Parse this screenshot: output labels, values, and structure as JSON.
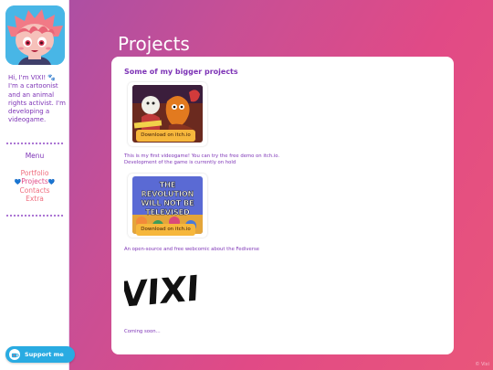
{
  "sidebar": {
    "intro": "Hi, I'm VIXI! 🐾 I'm a cartoonist and an animal rights activist. I'm developing a videogame.",
    "menu_title": "Menu",
    "nav": [
      {
        "label": "Portfolio",
        "active": false
      },
      {
        "label": "Projects",
        "active": true
      },
      {
        "label": "Contacts",
        "active": false
      },
      {
        "label": "Extra",
        "active": false
      }
    ],
    "support_label": "Support me"
  },
  "main": {
    "title": "Projects",
    "section_heading": "Some of my bigger projects",
    "projects": [
      {
        "button": "Download on itch.io",
        "description": "This is my first videogame! You can try the free demo on itch.io. Development of the game is currently on hold",
        "cover": "game-cover"
      },
      {
        "button": "Download on itch.io",
        "description": "An open-source and free webcomic about the Fediverse",
        "cover_text": [
          "THE",
          "REVOLUTION",
          "WILL NOT BE",
          "TELEVISED"
        ]
      },
      {
        "logo_text": "VIXI",
        "description": "Coming soon..."
      }
    ]
  },
  "footer": {
    "corner_text": "© Vixi"
  }
}
